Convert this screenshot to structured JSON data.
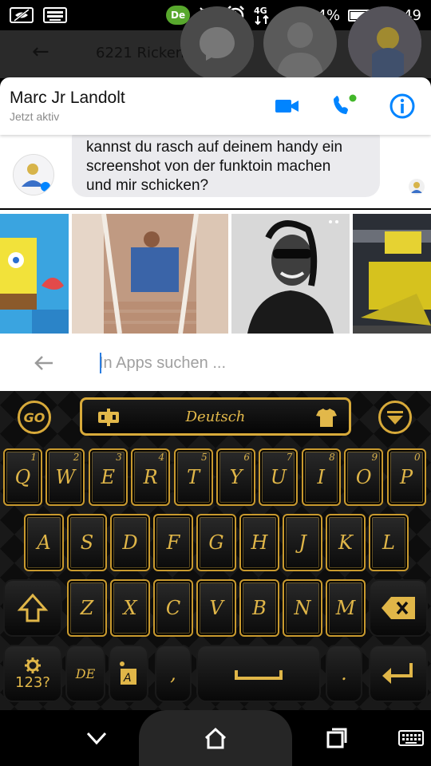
{
  "status_bar": {
    "battery_percent_text": "94%",
    "battery_level": 0.94,
    "time": "05:49",
    "network_type": "4G",
    "icons": [
      "eye-slash-icon",
      "keyboard-icon",
      "de-app-icon",
      "mute-icon",
      "alarm-icon",
      "data-icon",
      "signal-icon",
      "battery-icon"
    ],
    "de_badge": "De"
  },
  "background_app": {
    "title": "6221 Ricken"
  },
  "chat_header": {
    "name": "Marc Jr Landolt",
    "status": "Jetzt aktiv",
    "accent_color": "#0084ff"
  },
  "message": {
    "text_lines": [
      "kannst du rasch auf deinem handy ein",
      "screenshot von der funktoin machen",
      "und mir schicken?"
    ]
  },
  "search": {
    "placeholder": "In Apps suchen ..."
  },
  "keyboard": {
    "language": "Deutsch",
    "go_label": "GO",
    "row1": [
      {
        "label": "Q",
        "hint": "1"
      },
      {
        "label": "W",
        "hint": "2"
      },
      {
        "label": "E",
        "hint": "3"
      },
      {
        "label": "R",
        "hint": "4"
      },
      {
        "label": "T",
        "hint": "5"
      },
      {
        "label": "Y",
        "hint": "6"
      },
      {
        "label": "U",
        "hint": "7"
      },
      {
        "label": "I",
        "hint": "8"
      },
      {
        "label": "O",
        "hint": "9"
      },
      {
        "label": "P",
        "hint": "0"
      }
    ],
    "row2": [
      "A",
      "S",
      "D",
      "F",
      "G",
      "H",
      "J",
      "K",
      "L"
    ],
    "row3": [
      "Z",
      "X",
      "C",
      "V",
      "B",
      "N",
      "M"
    ],
    "symbols_label": "123?",
    "lang_key_label": "DE",
    "comma": ",",
    "period": ".",
    "gold_color": "#d8aa3a"
  }
}
